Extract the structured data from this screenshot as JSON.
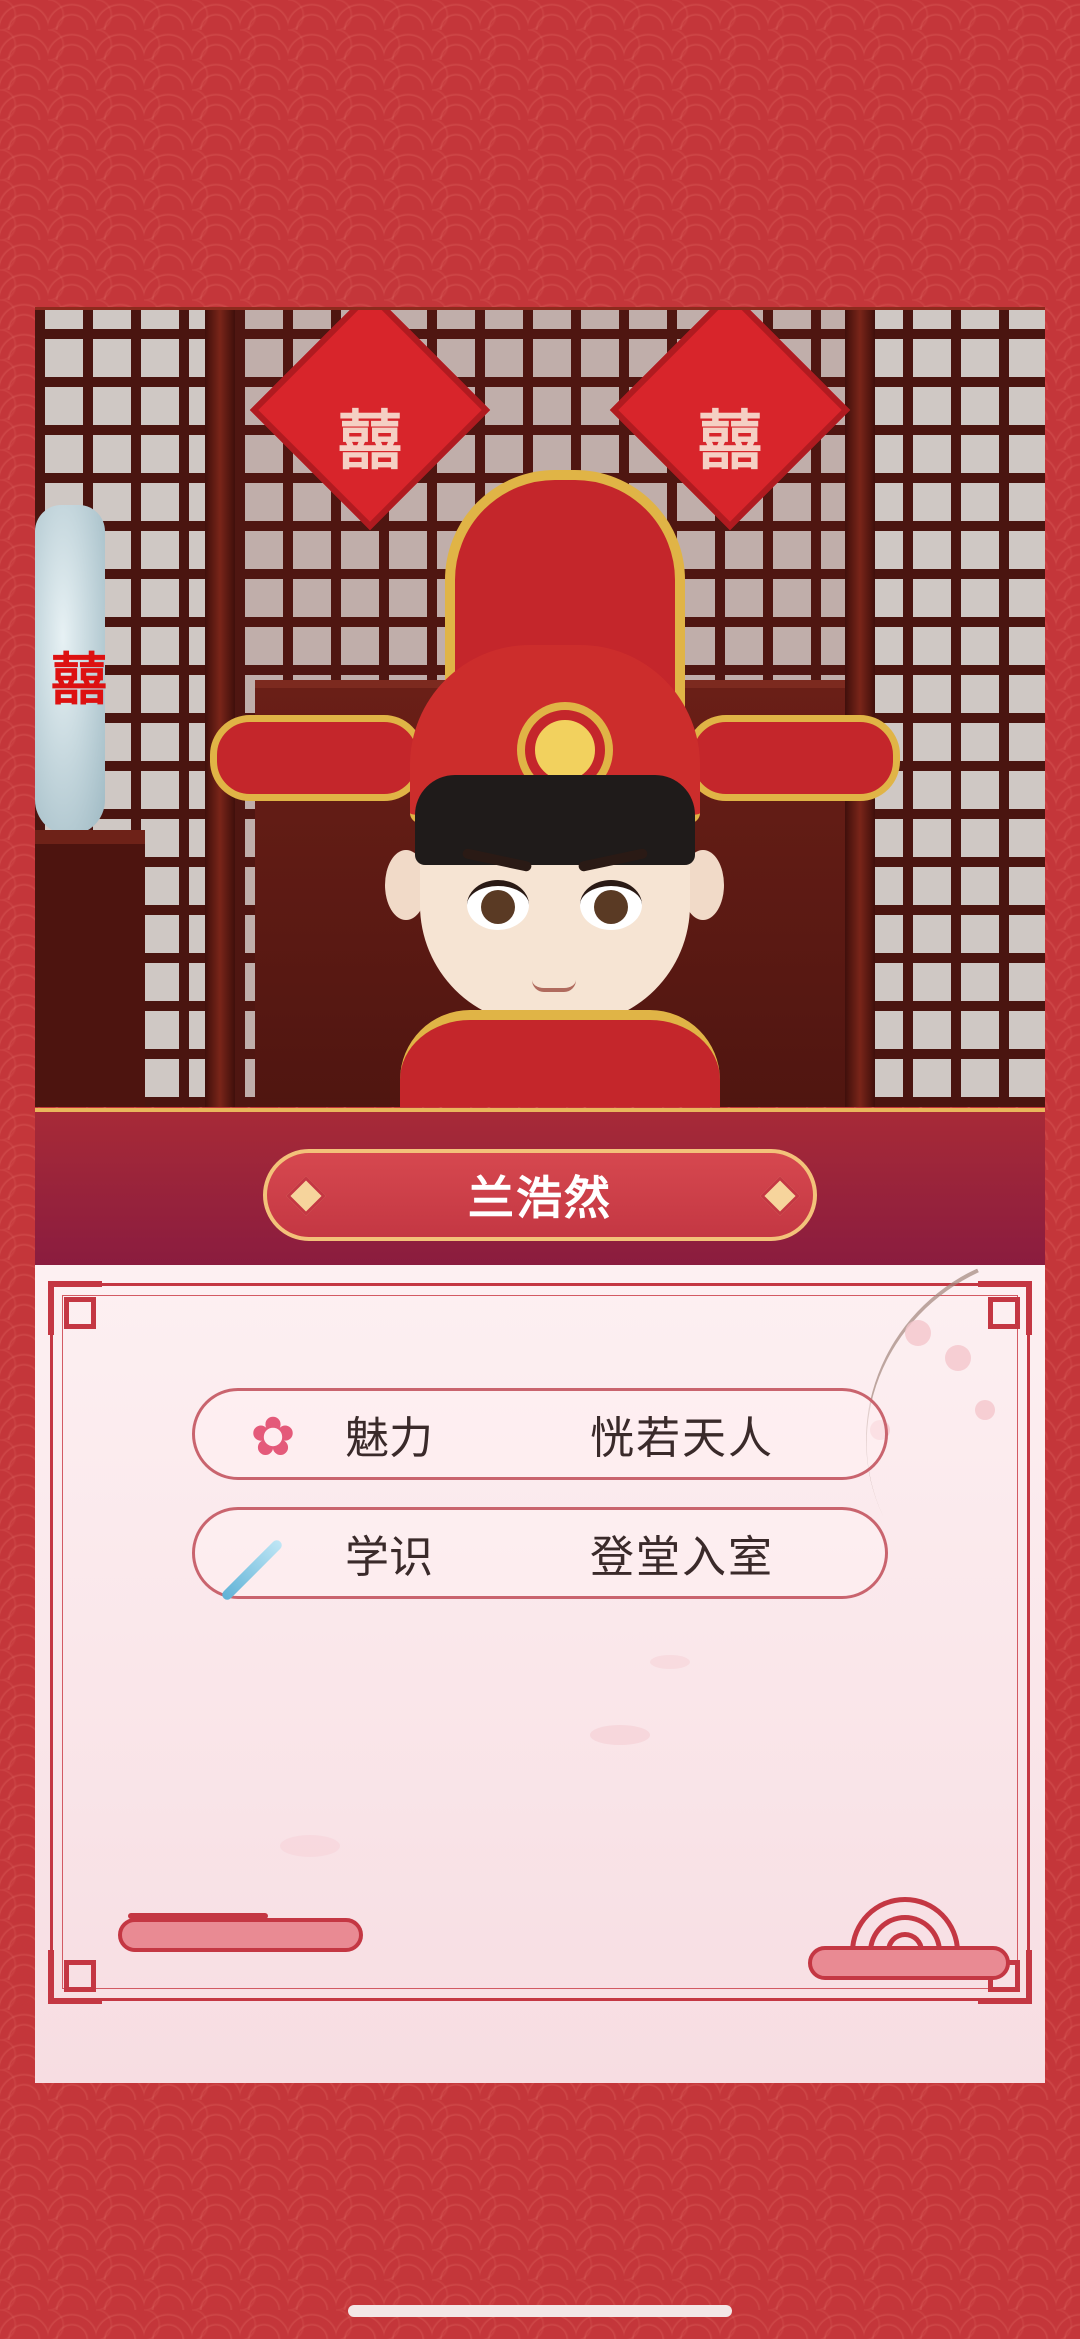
{
  "character": {
    "name": "兰浩然"
  },
  "stats": [
    {
      "label": "魅力",
      "value": "恍若天人",
      "icon": "plum-blossom-icon"
    },
    {
      "label": "学识",
      "value": "登堂入室",
      "icon": "writing-brush-icon"
    }
  ],
  "decor": {
    "papercut_glyph": "囍",
    "vase_glyph": "囍"
  },
  "colors": {
    "background": "#c4362a",
    "name_band": "#8a1c3f",
    "accent_gold": "#e0b446",
    "card": "#fdf0f2",
    "frame": "#c43743"
  }
}
